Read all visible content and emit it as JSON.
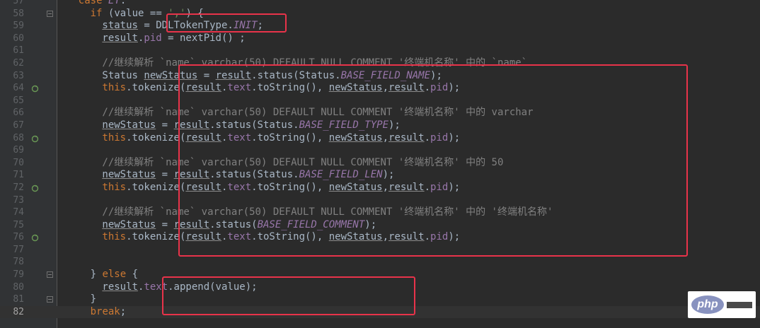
{
  "editor": {
    "language": "java",
    "current_line": "82",
    "colors": {
      "background": "#2b2b2b",
      "gutter": "#313335",
      "keyword": "#cc7832",
      "string": "#6a8759",
      "comment": "#808080",
      "constant": "#9876aa",
      "highlight_box": "#e8334a"
    },
    "lines": [
      {
        "n": "57",
        "mark": "",
        "fold": false,
        "indent": 6,
        "tokens": [
          [
            "kw",
            "case "
          ],
          [
            "const",
            "ET"
          ],
          [
            "p",
            ":"
          ]
        ]
      },
      {
        "n": "58",
        "mark": "",
        "fold": true,
        "indent": 7,
        "tokens": [
          [
            "kw",
            "if "
          ],
          [
            "p",
            "(value == "
          ],
          [
            "str",
            "','"
          ],
          [
            "p",
            ") {"
          ]
        ]
      },
      {
        "n": "59",
        "mark": "",
        "fold": false,
        "indent": 8,
        "tokens": [
          [
            "u",
            "status"
          ],
          [
            "p",
            " = DDLTokenType."
          ],
          [
            "const",
            "INIT"
          ],
          [
            "p",
            ";"
          ]
        ]
      },
      {
        "n": "60",
        "mark": "",
        "fold": false,
        "indent": 8,
        "tokens": [
          [
            "u",
            "result"
          ],
          [
            "p",
            "."
          ],
          [
            "fld",
            "pid"
          ],
          [
            "p",
            " = nextPid() ;"
          ]
        ]
      },
      {
        "n": "61",
        "mark": "",
        "fold": false,
        "indent": 0,
        "tokens": []
      },
      {
        "n": "62",
        "mark": "",
        "fold": false,
        "indent": 8,
        "tokens": [
          [
            "cmt",
            "//继续解析 `name` varchar(50) DEFAULT NULL COMMENT '终端机名称' 中的 `name`"
          ]
        ]
      },
      {
        "n": "63",
        "mark": "",
        "fold": false,
        "indent": 8,
        "tokens": [
          [
            "p",
            "Status "
          ],
          [
            "u",
            "newStatus"
          ],
          [
            "p",
            " = "
          ],
          [
            "u",
            "result"
          ],
          [
            "p",
            ".status(Status."
          ],
          [
            "const",
            "BASE_FIELD_NAME"
          ],
          [
            "p",
            ");"
          ]
        ]
      },
      {
        "n": "64",
        "mark": "recursive",
        "fold": false,
        "indent": 8,
        "tokens": [
          [
            "kw",
            "this"
          ],
          [
            "p",
            ".tokenize("
          ],
          [
            "u",
            "result"
          ],
          [
            "p",
            "."
          ],
          [
            "fld",
            "text"
          ],
          [
            "p",
            ".toString(), "
          ],
          [
            "u",
            "newStatus"
          ],
          [
            "p",
            ","
          ],
          [
            "u",
            "result"
          ],
          [
            "p",
            "."
          ],
          [
            "fld",
            "pid"
          ],
          [
            "p",
            ");"
          ]
        ]
      },
      {
        "n": "65",
        "mark": "",
        "fold": false,
        "indent": 0,
        "tokens": []
      },
      {
        "n": "66",
        "mark": "",
        "fold": false,
        "indent": 8,
        "tokens": [
          [
            "cmt",
            "//继续解析 `name` varchar(50) DEFAULT NULL COMMENT '终端机名称' 中的 varchar"
          ]
        ]
      },
      {
        "n": "67",
        "mark": "",
        "fold": false,
        "indent": 8,
        "tokens": [
          [
            "u",
            "newStatus"
          ],
          [
            "p",
            " = "
          ],
          [
            "u",
            "result"
          ],
          [
            "p",
            ".status(Status."
          ],
          [
            "const",
            "BASE_FIELD_TYPE"
          ],
          [
            "p",
            ");"
          ]
        ]
      },
      {
        "n": "68",
        "mark": "recursive",
        "fold": false,
        "indent": 8,
        "tokens": [
          [
            "kw",
            "this"
          ],
          [
            "p",
            ".tokenize("
          ],
          [
            "u",
            "result"
          ],
          [
            "p",
            "."
          ],
          [
            "fld",
            "text"
          ],
          [
            "p",
            ".toString(), "
          ],
          [
            "u",
            "newStatus"
          ],
          [
            "p",
            ","
          ],
          [
            "u",
            "result"
          ],
          [
            "p",
            "."
          ],
          [
            "fld",
            "pid"
          ],
          [
            "p",
            ");"
          ]
        ]
      },
      {
        "n": "69",
        "mark": "",
        "fold": false,
        "indent": 0,
        "tokens": []
      },
      {
        "n": "70",
        "mark": "",
        "fold": false,
        "indent": 8,
        "tokens": [
          [
            "cmt",
            "//继续解析 `name` varchar(50) DEFAULT NULL COMMENT '终端机名称' 中的 50"
          ]
        ]
      },
      {
        "n": "71",
        "mark": "",
        "fold": false,
        "indent": 8,
        "tokens": [
          [
            "u",
            "newStatus"
          ],
          [
            "p",
            " = "
          ],
          [
            "u",
            "result"
          ],
          [
            "p",
            ".status(Status."
          ],
          [
            "const",
            "BASE_FIELD_LEN"
          ],
          [
            "p",
            ");"
          ]
        ]
      },
      {
        "n": "72",
        "mark": "recursive",
        "fold": false,
        "indent": 8,
        "tokens": [
          [
            "kw",
            "this"
          ],
          [
            "p",
            ".tokenize("
          ],
          [
            "u",
            "result"
          ],
          [
            "p",
            "."
          ],
          [
            "fld",
            "text"
          ],
          [
            "p",
            ".toString(), "
          ],
          [
            "u",
            "newStatus"
          ],
          [
            "p",
            ","
          ],
          [
            "u",
            "result"
          ],
          [
            "p",
            "."
          ],
          [
            "fld",
            "pid"
          ],
          [
            "p",
            ");"
          ]
        ]
      },
      {
        "n": "73",
        "mark": "",
        "fold": false,
        "indent": 0,
        "tokens": []
      },
      {
        "n": "74",
        "mark": "",
        "fold": false,
        "indent": 8,
        "tokens": [
          [
            "cmt",
            "//继续解析 `name` varchar(50) DEFAULT NULL COMMENT '终端机名称' 中的 '终端机名称'"
          ]
        ]
      },
      {
        "n": "75",
        "mark": "",
        "fold": false,
        "indent": 8,
        "tokens": [
          [
            "u",
            "newStatus"
          ],
          [
            "p",
            " = "
          ],
          [
            "u",
            "result"
          ],
          [
            "p",
            ".status("
          ],
          [
            "const",
            "BASE_FIELD_COMMENT"
          ],
          [
            "p",
            ");"
          ]
        ]
      },
      {
        "n": "76",
        "mark": "recursive",
        "fold": false,
        "indent": 8,
        "tokens": [
          [
            "kw",
            "this"
          ],
          [
            "p",
            ".tokenize("
          ],
          [
            "u",
            "result"
          ],
          [
            "p",
            "."
          ],
          [
            "fld",
            "text"
          ],
          [
            "p",
            ".toString(), "
          ],
          [
            "u",
            "newStatus"
          ],
          [
            "p",
            ","
          ],
          [
            "u",
            "result"
          ],
          [
            "p",
            "."
          ],
          [
            "fld",
            "pid"
          ],
          [
            "p",
            ");"
          ]
        ]
      },
      {
        "n": "77",
        "mark": "",
        "fold": false,
        "indent": 0,
        "tokens": []
      },
      {
        "n": "78",
        "mark": "",
        "fold": false,
        "indent": 0,
        "tokens": []
      },
      {
        "n": "79",
        "mark": "",
        "fold": true,
        "indent": 7,
        "tokens": [
          [
            "p",
            "} "
          ],
          [
            "kw",
            "else"
          ],
          [
            "p",
            " {"
          ]
        ]
      },
      {
        "n": "80",
        "mark": "",
        "fold": false,
        "indent": 8,
        "tokens": [
          [
            "u",
            "result"
          ],
          [
            "p",
            "."
          ],
          [
            "fld",
            "text"
          ],
          [
            "p",
            ".append(value);"
          ]
        ]
      },
      {
        "n": "81",
        "mark": "",
        "fold": true,
        "indent": 7,
        "tokens": [
          [
            "p",
            "}"
          ]
        ]
      },
      {
        "n": "82",
        "mark": "",
        "fold": false,
        "indent": 7,
        "tokens": [
          [
            "kw",
            "break"
          ],
          [
            "p",
            ";"
          ]
        ]
      }
    ]
  },
  "watermark": {
    "logo_text": "php"
  }
}
